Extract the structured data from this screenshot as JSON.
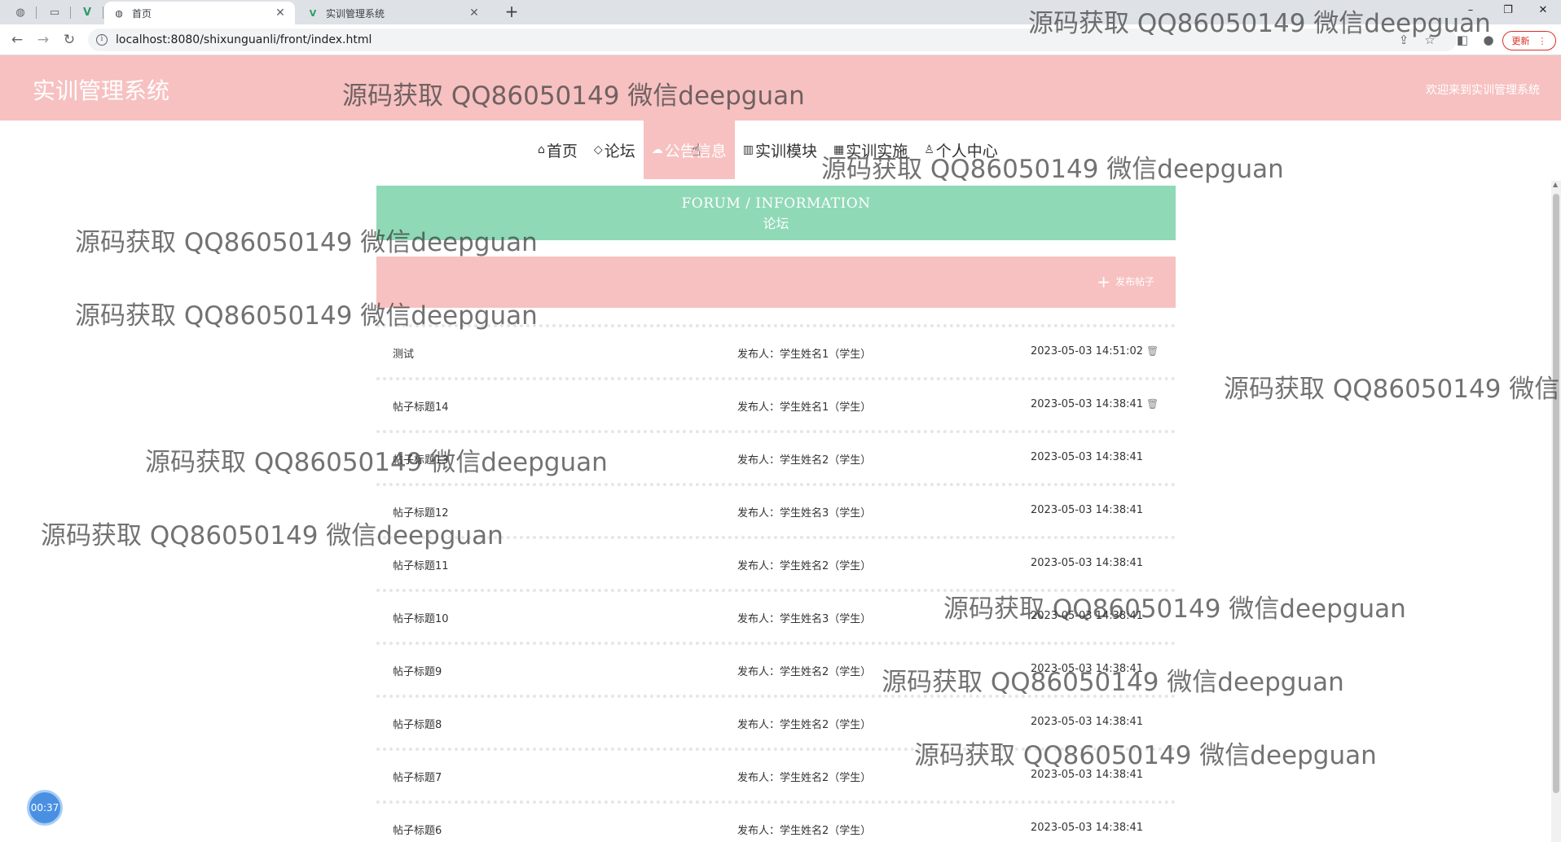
{
  "browser": {
    "tabs": [
      {
        "title": "首页",
        "favicon": "globe-icon",
        "active": true
      },
      {
        "title": "实训管理系统",
        "favicon": "vue-logo-icon",
        "active": false
      }
    ],
    "url": "localhost:8080/shixunguanli/front/index.html",
    "update_label": "更新"
  },
  "header": {
    "site_title": "实训管理系统",
    "welcome": "欢迎来到实训管理系统"
  },
  "nav": {
    "items": [
      {
        "label": "首页",
        "icon": "home-icon"
      },
      {
        "label": "论坛",
        "icon": "tag-icon"
      },
      {
        "label": "公告信息",
        "icon": "cloud-icon",
        "active": true
      },
      {
        "label": "实训模块",
        "icon": "book-icon"
      },
      {
        "label": "实训实施",
        "icon": "grid-icon"
      },
      {
        "label": "个人中心",
        "icon": "user-icon"
      }
    ]
  },
  "banner": {
    "en": "FORUM / INFORMATION",
    "zh": "论坛"
  },
  "actions": {
    "post_label": "发布帖子"
  },
  "posts": [
    {
      "title": "测试",
      "publisher": "发布人：学生姓名1（学生）",
      "date": "2023-05-03 14:51:02",
      "deletable": true
    },
    {
      "title": "帖子标题14",
      "publisher": "发布人：学生姓名1（学生）",
      "date": "2023-05-03 14:38:41",
      "deletable": true
    },
    {
      "title": "帖子标题13",
      "publisher": "发布人：学生姓名2（学生）",
      "date": "2023-05-03 14:38:41",
      "deletable": false
    },
    {
      "title": "帖子标题12",
      "publisher": "发布人：学生姓名3（学生）",
      "date": "2023-05-03 14:38:41",
      "deletable": false
    },
    {
      "title": "帖子标题11",
      "publisher": "发布人：学生姓名2（学生）",
      "date": "2023-05-03 14:38:41",
      "deletable": false
    },
    {
      "title": "帖子标题10",
      "publisher": "发布人：学生姓名3（学生）",
      "date": "2023-05-03 14:38:41",
      "deletable": false
    },
    {
      "title": "帖子标题9",
      "publisher": "发布人：学生姓名2（学生）",
      "date": "2023-05-03 14:38:41",
      "deletable": false
    },
    {
      "title": "帖子标题8",
      "publisher": "发布人：学生姓名2（学生）",
      "date": "2023-05-03 14:38:41",
      "deletable": false
    },
    {
      "title": "帖子标题7",
      "publisher": "发布人：学生姓名2（学生）",
      "date": "2023-05-03 14:38:41",
      "deletable": false
    },
    {
      "title": "帖子标题6",
      "publisher": "发布人：学生姓名2（学生）",
      "date": "2023-05-03 14:38:41",
      "deletable": false
    }
  ],
  "timer": "00:37",
  "watermark": "源码获取 QQ86050149 微信deepguan",
  "colors": {
    "header_bg": "#f7c1c1",
    "banner_bg": "#8fd9b6",
    "timer_bg": "#4a90e2"
  }
}
